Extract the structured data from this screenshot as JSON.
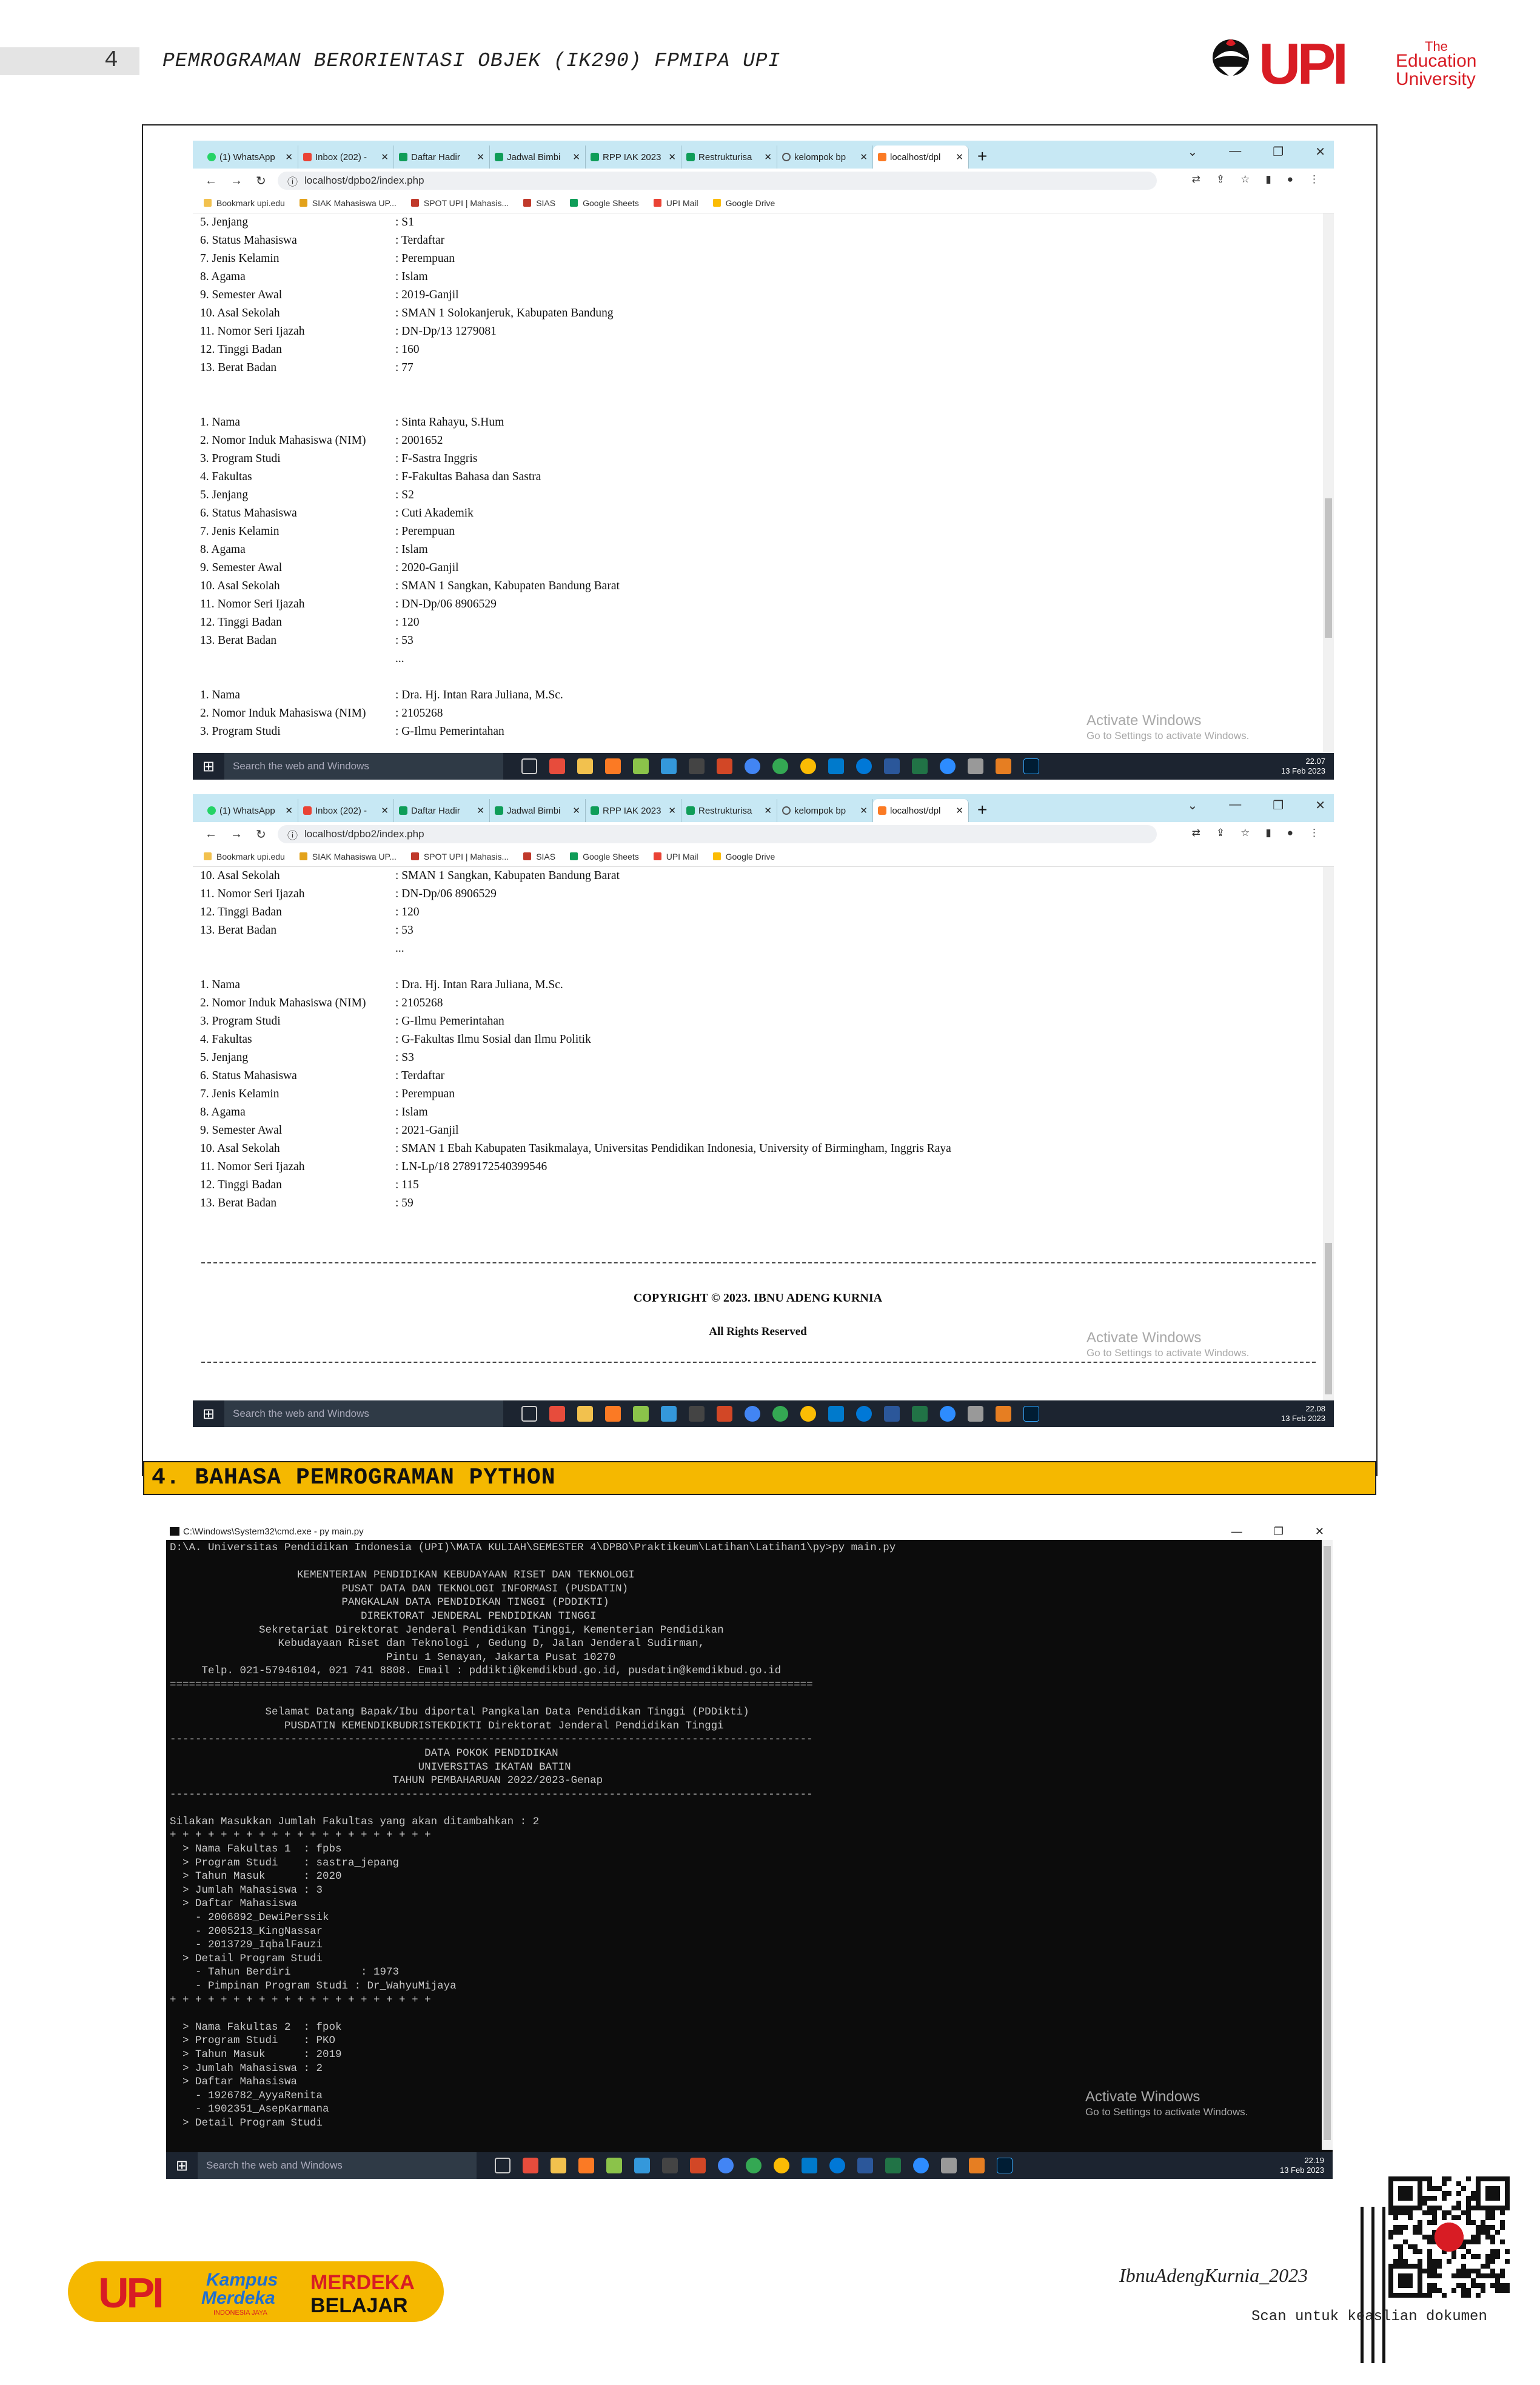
{
  "header": {
    "page_number": "4",
    "running_title": "PEMROGRAMAN BERORIENTASI OBJEK (IK290) FPMIPA UPI",
    "logo_tagline_1": "The",
    "logo_tagline_2": "Education",
    "logo_tagline_3": "University"
  },
  "browser": {
    "tabs": [
      "(1) WhatsApp",
      "Inbox (202) -",
      "Daftar Hadir",
      "Jadwal Bimbi",
      "RPP IAK 2023",
      "Restrukturisa",
      "kelompok bp",
      "localhost/dpl"
    ],
    "url": "localhost/dpbo2/index.php",
    "bookmarks": [
      "Bookmark upi.edu",
      "SIAK Mahasiswa UP...",
      "SPOT UPI | Mahasis...",
      "SIAS",
      "Google Sheets",
      "UPI Mail",
      "Google Drive"
    ],
    "activate_title": "Activate Windows",
    "activate_sub": "Go to Settings to activate Windows.",
    "taskbar_search": "Search the web and Windows"
  },
  "shot1": {
    "time": "22.07",
    "date": "13 Feb 2023",
    "rows": [
      {
        "label": "5. Jenjang",
        "value": ": S1"
      },
      {
        "label": "6. Status Mahasiswa",
        "value": ": Terdaftar"
      },
      {
        "label": "7. Jenis Kelamin",
        "value": ": Perempuan"
      },
      {
        "label": "8. Agama",
        "value": ": Islam"
      },
      {
        "label": "9. Semester Awal",
        "value": ": 2019-Ganjil"
      },
      {
        "label": "10. Asal Sekolah",
        "value": ": SMAN 1 Solokanjeruk, Kabupaten Bandung"
      },
      {
        "label": "11. Nomor Seri Ijazah",
        "value": ": DN-Dp/13 1279081"
      },
      {
        "label": "12. Tinggi Badan",
        "value": ": 160"
      },
      {
        "label": "13. Berat Badan",
        "value": ": 77"
      },
      {
        "label": "",
        "value": ""
      },
      {
        "label": "",
        "value": ""
      },
      {
        "label": "1. Nama",
        "value": ": Sinta Rahayu, S.Hum"
      },
      {
        "label": "2. Nomor Induk Mahasiswa (NIM)",
        "value": ": 2001652"
      },
      {
        "label": "3. Program Studi",
        "value": ": F-Sastra Inggris"
      },
      {
        "label": "4. Fakultas",
        "value": ": F-Fakultas Bahasa dan Sastra"
      },
      {
        "label": "5. Jenjang",
        "value": ": S2"
      },
      {
        "label": "6. Status Mahasiswa",
        "value": ": Cuti Akademik"
      },
      {
        "label": "7. Jenis Kelamin",
        "value": ": Perempuan"
      },
      {
        "label": "8. Agama",
        "value": ": Islam"
      },
      {
        "label": "9. Semester Awal",
        "value": ": 2020-Ganjil"
      },
      {
        "label": "10. Asal Sekolah",
        "value": ": SMAN 1 Sangkan, Kabupaten Bandung Barat"
      },
      {
        "label": "11. Nomor Seri Ijazah",
        "value": ": DN-Dp/06 8906529"
      },
      {
        "label": "12. Tinggi Badan",
        "value": ": 120"
      },
      {
        "label": "13. Berat Badan",
        "value": ": 53"
      },
      {
        "label": "",
        "value": "..."
      },
      {
        "label": "",
        "value": ""
      },
      {
        "label": "1. Nama",
        "value": ": Dra. Hj. Intan Rara Juliana, M.Sc."
      },
      {
        "label": "2. Nomor Induk Mahasiswa (NIM)",
        "value": ": 2105268"
      },
      {
        "label": "3. Program Studi",
        "value": ": G-Ilmu Pemerintahan"
      }
    ]
  },
  "shot2": {
    "time": "22.08",
    "date": "13 Feb 2023",
    "rows": [
      {
        "label": "10. Asal Sekolah",
        "value": ": SMAN 1 Sangkan, Kabupaten Bandung Barat"
      },
      {
        "label": "11. Nomor Seri Ijazah",
        "value": ": DN-Dp/06 8906529"
      },
      {
        "label": "12. Tinggi Badan",
        "value": ": 120"
      },
      {
        "label": "13. Berat Badan",
        "value": ": 53"
      },
      {
        "label": "",
        "value": "..."
      },
      {
        "label": "",
        "value": ""
      },
      {
        "label": "1. Nama",
        "value": ": Dra. Hj. Intan Rara Juliana, M.Sc."
      },
      {
        "label": "2. Nomor Induk Mahasiswa (NIM)",
        "value": ": 2105268"
      },
      {
        "label": "3. Program Studi",
        "value": ": G-Ilmu Pemerintahan"
      },
      {
        "label": "4. Fakultas",
        "value": ": G-Fakultas Ilmu Sosial dan Ilmu Politik"
      },
      {
        "label": "5. Jenjang",
        "value": ": S3"
      },
      {
        "label": "6. Status Mahasiswa",
        "value": ": Terdaftar"
      },
      {
        "label": "7. Jenis Kelamin",
        "value": ": Perempuan"
      },
      {
        "label": "8. Agama",
        "value": ": Islam"
      },
      {
        "label": "9. Semester Awal",
        "value": ": 2021-Ganjil"
      },
      {
        "label": "10. Asal Sekolah",
        "value": ": SMAN 1 Ebah Kabupaten Tasikmalaya, Universitas Pendidikan Indonesia, University of Birmingham, Inggris Raya"
      },
      {
        "label": "11. Nomor Seri Ijazah",
        "value": ": LN-Lp/18 2789172540399546"
      },
      {
        "label": "12. Tinggi Badan",
        "value": ": 115"
      },
      {
        "label": "13. Berat Badan",
        "value": ": 59"
      }
    ],
    "copyright": "COPYRIGHT © 2023. IBNU ADENG KURNIA",
    "rights": "All Rights Reserved"
  },
  "section": {
    "title": "4. BAHASA PEMROGRAMAN PYTHON"
  },
  "cmd": {
    "title": "C:\\Windows\\System32\\cmd.exe - py  main.py",
    "time": "22.19",
    "date": "13 Feb 2023",
    "lines": [
      "D:\\A. Universitas Pendidikan Indonesia (UPI)\\MATA KULIAH\\SEMESTER 4\\DPBO\\Praktikeum\\Latihan\\Latihan1\\py>py main.py",
      "",
      "                    KEMENTERIAN PENDIDIKAN KEBUDAYAAN RISET DAN TEKNOLOGI",
      "                           PUSAT DATA DAN TEKNOLOGI INFORMASI (PUSDATIN)",
      "                           PANGKALAN DATA PENDIDIKAN TINGGI (PDDIKTI)",
      "                              DIREKTORAT JENDERAL PENDIDIKAN TINGGI",
      "              Sekretariat Direktorat Jenderal Pendidikan Tinggi, Kementerian Pendidikan",
      "                 Kebudayaan Riset dan Teknologi , Gedung D, Jalan Jenderal Sudirman,",
      "                                  Pintu 1 Senayan, Jakarta Pusat 10270",
      "     Telp. 021-57946104, 021 741 8808. Email : pddikti@kemdikbud.go.id, pusdatin@kemdikbud.go.id",
      "=====================================================================================================",
      "",
      "               Selamat Datang Bapak/Ibu diportal Pangkalan Data Pendidikan Tinggi (PDDikti)",
      "                  PUSDATIN KEMENDIKBUDRISTEKDIKTI Direktorat Jenderal Pendidikan Tinggi",
      "-----------------------------------------------------------------------------------------------------",
      "                                        DATA POKOK PENDIDIKAN",
      "                                       UNIVERSITAS IKATAN BATIN",
      "                                   TAHUN PEMBAHARUAN 2022/2023-Genap",
      "-----------------------------------------------------------------------------------------------------",
      "",
      "Silakan Masukkan Jumlah Fakultas yang akan ditambahkan : 2",
      "+ + + + + + + + + + + + + + + + + + + + +",
      "  > Nama Fakultas 1  : fpbs",
      "  > Program Studi    : sastra_jepang",
      "  > Tahun Masuk      : 2020",
      "  > Jumlah Mahasiswa : 3",
      "  > Daftar Mahasiswa",
      "    - 2006892_DewiPerssik",
      "    - 2005213_KingNassar",
      "    - 2013729_IqbalFauzi",
      "  > Detail Program Studi",
      "    - Tahun Berdiri           : 1973",
      "    - Pimpinan Program Studi : Dr_WahyuMijaya",
      "+ + + + + + + + + + + + + + + + + + + + +",
      "",
      "  > Nama Fakultas 2  : fpok",
      "  > Program Studi    : PKO",
      "  > Tahun Masuk      : 2019",
      "  > Jumlah Mahasiswa : 2",
      "  > Daftar Mahasiswa",
      "    - 1926782_AyyaRenita",
      "    - 1902351_AsepKarmana",
      "  > Detail Program Studi"
    ]
  },
  "footer": {
    "kampus_1": "Kampus",
    "kampus_2": "Merdeka",
    "kampus_3": "INDONESIA JAYA",
    "merdeka_1": "MERDEKA",
    "merdeka_2": "BELAJAR",
    "signature": "IbnuAdengKurnia_2023",
    "scan_note": "Scan untuk keaslian dokumen"
  },
  "colors": {
    "accent_yellow": "#f5b800",
    "upi_red": "#d81c24",
    "tab_blue": "#c7e8f4"
  }
}
